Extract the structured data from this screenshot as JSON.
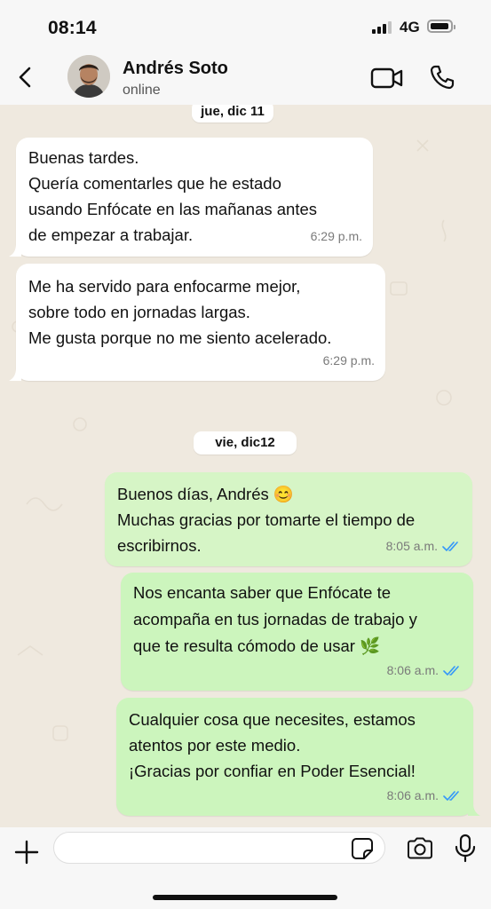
{
  "status_bar": {
    "time": "08:14",
    "network": "4G"
  },
  "header": {
    "contact_name": "Andrés Soto",
    "contact_status": "online"
  },
  "days": [
    {
      "label": "jue, dic 11",
      "messages": [
        {
          "direction": "in",
          "lines": [
            "Buenas tardes.",
            "Quería comentarles que he estado",
            "usando Enfócate en las mañanas antes",
            "de empezar a trabajar."
          ],
          "time": "6:29 p.m."
        },
        {
          "direction": "in",
          "lines": [
            "Me ha servido para enfocarme mejor,",
            "sobre todo en jornadas largas.",
            "Me gusta porque no me siento acelerado."
          ],
          "time": "6:29 p.m."
        }
      ]
    },
    {
      "label": "vie, dic12",
      "messages": [
        {
          "direction": "out",
          "lines": [
            "Buenos días, Andrés 😊",
            "Muchas gracias por tomarte el tiempo de",
            "escribirnos."
          ],
          "time": "8:05 a.m.",
          "read": true
        },
        {
          "direction": "out",
          "lines": [
            "Nos encanta saber que Enfócate te",
            "acompaña en tus jornadas de trabajo y",
            "que te resulta cómodo de usar 🌿"
          ],
          "time": "8:06 a.m.",
          "read": true
        },
        {
          "direction": "out",
          "lines": [
            "Cualquier cosa que necesites, estamos",
            "atentos por este medio.",
            "¡Gracias por confiar en Poder Esencial!"
          ],
          "time": "8:06 a.m.",
          "read": true
        }
      ]
    }
  ],
  "composer": {
    "input_value": "",
    "input_placeholder": ""
  },
  "icons": {
    "back": "chevron-left-icon",
    "video": "video-camera-icon",
    "call": "phone-icon",
    "plus": "plus-icon",
    "sticker": "sticker-icon",
    "camera": "camera-icon",
    "mic": "microphone-icon",
    "read_receipt": "double-check-icon"
  },
  "colors": {
    "chat_background": "#efe9df",
    "incoming_bubble": "#ffffff",
    "outgoing_bubble": "#d6f5c6",
    "read_tick": "#3497f9"
  }
}
